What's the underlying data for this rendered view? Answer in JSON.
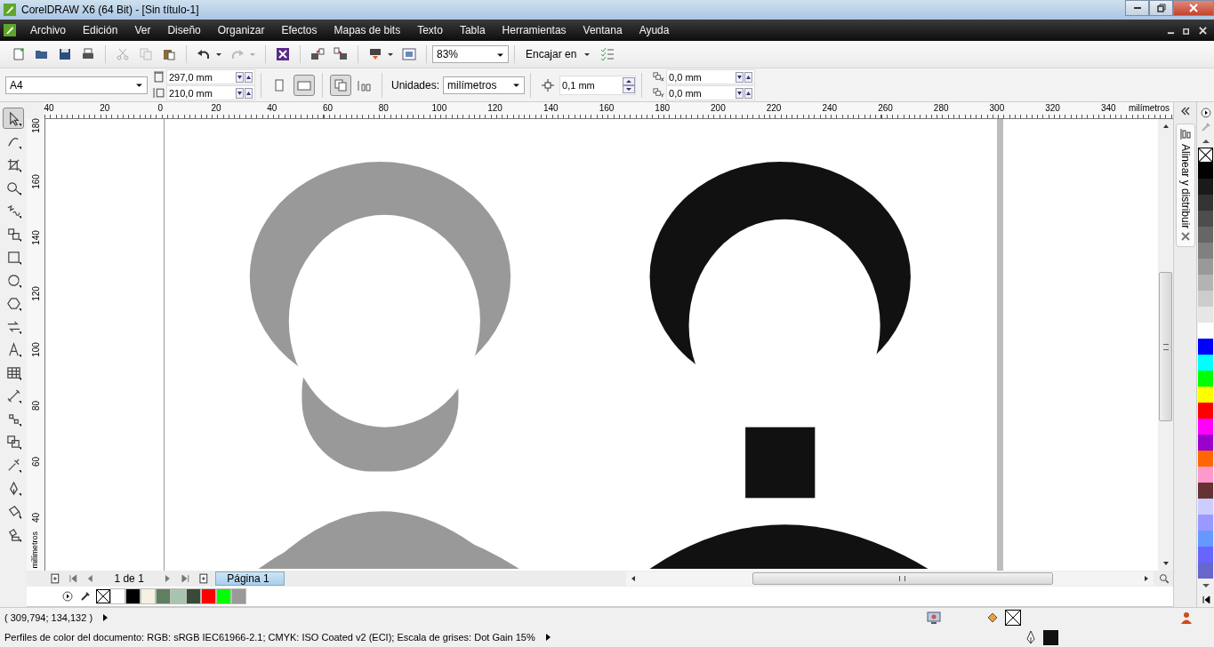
{
  "window": {
    "title": "CorelDRAW X6 (64 Bit) - [Sin título-1]"
  },
  "menu": {
    "items": [
      "Archivo",
      "Edición",
      "Ver",
      "Diseño",
      "Organizar",
      "Efectos",
      "Mapas de bits",
      "Texto",
      "Tabla",
      "Herramientas",
      "Ventana",
      "Ayuda"
    ]
  },
  "toolbar": {
    "zoom": "83%",
    "snap": "Encajar en"
  },
  "property_bar": {
    "page_size": "A4",
    "width": "297,0 mm",
    "height": "210,0 mm",
    "orientation": [
      {
        "selected": false
      },
      {
        "selected": true
      }
    ],
    "units_label": "Unidades:",
    "units": "milímetros",
    "nudge": "0,1 mm",
    "duplicate_x": "0,0 mm",
    "duplicate_y": "0,0 mm"
  },
  "horizontal_ruler": {
    "ticks": [
      "40",
      "20",
      "0",
      "20",
      "40",
      "60",
      "80",
      "100",
      "120",
      "140",
      "160",
      "180",
      "200",
      "220",
      "240",
      "260",
      "280",
      "300",
      "320",
      "340"
    ],
    "unit": "milímetros"
  },
  "vertical_ruler": {
    "ticks": [
      "180",
      "160",
      "140",
      "120",
      "100",
      "80",
      "60",
      "40"
    ],
    "unit": "milímetros"
  },
  "toolbox": {
    "tools": [
      {
        "selected": true
      },
      {
        "selected": false
      },
      {
        "selected": false
      },
      {
        "selected": false
      },
      {
        "selected": false
      },
      {
        "selected": false
      },
      {
        "selected": false
      },
      {
        "selected": false
      },
      {
        "selected": false
      },
      {
        "selected": false
      },
      {
        "selected": false
      },
      {
        "selected": false
      },
      {
        "selected": false
      },
      {
        "selected": false
      },
      {
        "selected": false
      },
      {
        "selected": false
      },
      {
        "selected": false
      },
      {
        "selected": false
      },
      {
        "selected": false
      }
    ]
  },
  "docker": {
    "title": "Alinear y distribuir"
  },
  "palette": {
    "colors": [
      {
        "color": "#000000"
      },
      {
        "color": "#1a1a1a"
      },
      {
        "color": "#333333"
      },
      {
        "color": "#4d4d4d"
      },
      {
        "color": "#666666"
      },
      {
        "color": "#808080"
      },
      {
        "color": "#999999"
      },
      {
        "color": "#b3b3b3"
      },
      {
        "color": "#cccccc"
      },
      {
        "color": "#e6e6e6"
      },
      {
        "color": "#ffffff"
      },
      {
        "color": "#0000ff"
      },
      {
        "color": "#00ffff"
      },
      {
        "color": "#00ff00"
      },
      {
        "color": "#ffff00"
      },
      {
        "color": "#ff0000"
      },
      {
        "color": "#ff00ff"
      },
      {
        "color": "#9900cc"
      },
      {
        "color": "#ff6600"
      },
      {
        "color": "#ff99cc"
      },
      {
        "color": "#663333"
      },
      {
        "color": "#ccccff"
      },
      {
        "color": "#9999ff"
      },
      {
        "color": "#6699ff"
      },
      {
        "color": "#6666ff"
      },
      {
        "color": "#6666cc"
      }
    ]
  },
  "page_navigator": {
    "count": "1 de 1",
    "tabs": [
      {
        "label": "Página 1",
        "selected": true
      }
    ]
  },
  "document_palette": {
    "colors": [
      {
        "color": "#ffffff"
      },
      {
        "color": "#000000"
      },
      {
        "color": "#f5f0e1"
      },
      {
        "color": "#5f7f5f"
      },
      {
        "color": "#a9c4ae"
      },
      {
        "color": "#394a39"
      },
      {
        "color": "#ff0000"
      },
      {
        "color": "#00ff00"
      },
      {
        "color": "#999999"
      }
    ]
  },
  "status_bar": {
    "coordinates": "( 309,794; 134,132 )",
    "color_profiles": "Perfiles de color del documento: RGB: sRGB IEC61966-2.1; CMYK: ISO Coated v2 (ECI); Escala de grises: Dot Gain 15%"
  }
}
